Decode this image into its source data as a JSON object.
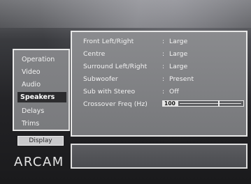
{
  "main": {
    "settings": [
      {
        "label": "Front Left/Right",
        "sep": ":",
        "value": "Large"
      },
      {
        "label": "Centre",
        "sep": ":",
        "value": "Large"
      },
      {
        "label": "Surround Left/Right",
        "sep": ":",
        "value": "Large"
      },
      {
        "label": "Subwoofer",
        "sep": ":",
        "value": "Present"
      },
      {
        "label": "Sub with Stereo",
        "sep": ":",
        "value": "Off"
      },
      {
        "label": "Crossover Freq (Hz)",
        "value": "100",
        "slider_level": 0.62
      }
    ]
  },
  "sidebar": {
    "items": [
      {
        "label": "Operation"
      },
      {
        "label": "Video"
      },
      {
        "label": "Audio"
      },
      {
        "label": "Speakers",
        "selected": true
      },
      {
        "label": "Delays"
      },
      {
        "label": "Trims"
      }
    ]
  },
  "display_button": {
    "label": "Display"
  },
  "logo": {
    "text": "ARCAM"
  }
}
